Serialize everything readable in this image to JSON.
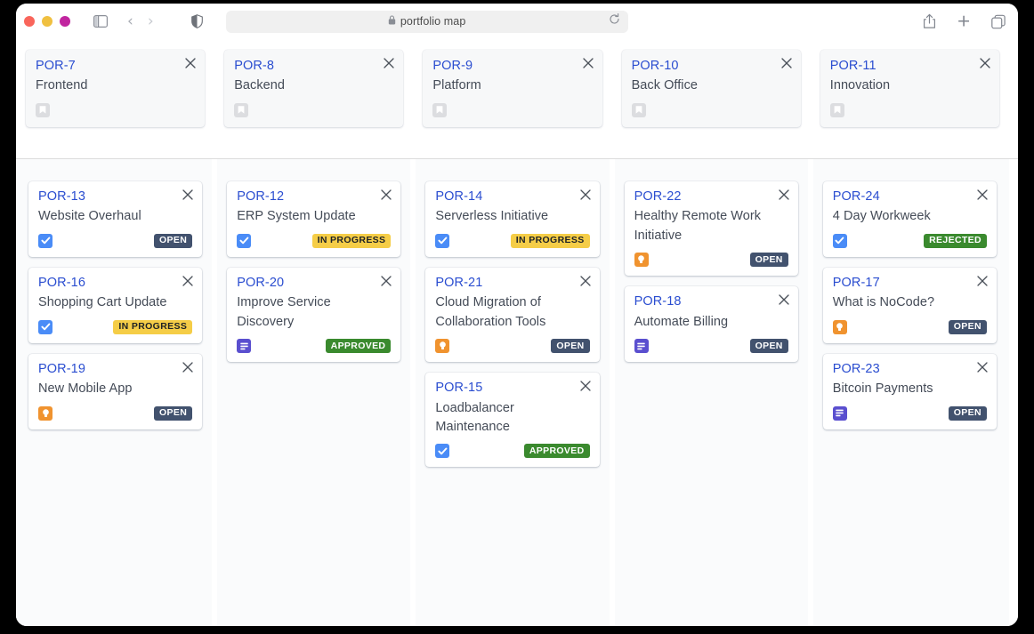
{
  "browser": {
    "url_text": "portfolio map",
    "lock_icon": "lock-icon",
    "reload_icon": "reload-icon",
    "sidebar_icon": "sidebar-toggle-icon",
    "back_glyph": "‹",
    "forward_glyph": "›",
    "shield_icon": "shield-icon",
    "share_icon": "share-icon",
    "new_tab_glyph": "+",
    "tabs_icon": "tab-overview-icon",
    "traffic_lights": [
      "close-red",
      "minimize-yellow",
      "zoom-purple"
    ]
  },
  "board": {
    "epics": [
      {
        "key": "POR-7",
        "title": "Frontend",
        "icon": "epic-bookmark-icon",
        "close": "×"
      },
      {
        "key": "POR-8",
        "title": "Backend",
        "icon": "epic-bookmark-icon",
        "close": "×"
      },
      {
        "key": "POR-9",
        "title": "Platform",
        "icon": "epic-bookmark-icon",
        "close": "×"
      },
      {
        "key": "POR-10",
        "title": "Back Office",
        "icon": "epic-bookmark-icon",
        "close": "×"
      },
      {
        "key": "POR-11",
        "title": "Innovation",
        "icon": "epic-bookmark-icon",
        "close": "×"
      }
    ],
    "columns": [
      {
        "cards": [
          {
            "key": "POR-13",
            "title": "Website Overhaul",
            "type": "task",
            "type_icon": "checkbox-task-icon",
            "status": "OPEN",
            "status_class": "open",
            "close": "×"
          },
          {
            "key": "POR-16",
            "title": "Shopping Cart Update",
            "type": "task",
            "type_icon": "checkbox-task-icon",
            "status": "IN PROGRESS",
            "status_class": "progress",
            "close": "×"
          },
          {
            "key": "POR-19",
            "title": "New Mobile App",
            "type": "idea",
            "type_icon": "lightbulb-idea-icon",
            "status": "OPEN",
            "status_class": "open",
            "close": "×"
          }
        ]
      },
      {
        "cards": [
          {
            "key": "POR-12",
            "title": "ERP System Update",
            "type": "task",
            "type_icon": "checkbox-task-icon",
            "status": "IN PROGRESS",
            "status_class": "progress",
            "close": "×"
          },
          {
            "key": "POR-20",
            "title": "Improve Service Discovery",
            "type": "doc",
            "type_icon": "document-icon",
            "status": "APPROVED",
            "status_class": "approved",
            "close": "×"
          }
        ]
      },
      {
        "cards": [
          {
            "key": "POR-14",
            "title": "Serverless Initiative",
            "type": "task",
            "type_icon": "checkbox-task-icon",
            "status": "IN PROGRESS",
            "status_class": "progress",
            "close": "×"
          },
          {
            "key": "POR-21",
            "title": "Cloud Migration of Collaboration Tools",
            "type": "idea",
            "type_icon": "lightbulb-idea-icon",
            "status": "OPEN",
            "status_class": "open",
            "close": "×"
          },
          {
            "key": "POR-15",
            "title": "Loadbalancer Maintenance",
            "type": "task",
            "type_icon": "checkbox-task-icon",
            "status": "APPROVED",
            "status_class": "approved",
            "close": "×"
          }
        ]
      },
      {
        "cards": [
          {
            "key": "POR-22",
            "title": "Healthy Remote Work Initiative",
            "type": "idea",
            "type_icon": "lightbulb-idea-icon",
            "status": "OPEN",
            "status_class": "open",
            "close": "×"
          },
          {
            "key": "POR-18",
            "title": "Automate Billing",
            "type": "doc",
            "type_icon": "document-icon",
            "status": "OPEN",
            "status_class": "open",
            "close": "×"
          }
        ]
      },
      {
        "cards": [
          {
            "key": "POR-24",
            "title": "4 Day Workweek",
            "type": "task",
            "type_icon": "checkbox-task-icon",
            "status": "REJECTED",
            "status_class": "rejected",
            "close": "×"
          },
          {
            "key": "POR-17",
            "title": "What is NoCode?",
            "type": "idea",
            "type_icon": "lightbulb-idea-icon",
            "status": "OPEN",
            "status_class": "open",
            "close": "×"
          },
          {
            "key": "POR-23",
            "title": "Bitcoin Payments",
            "type": "doc",
            "type_icon": "document-icon",
            "status": "OPEN",
            "status_class": "open",
            "close": "×"
          }
        ]
      }
    ]
  },
  "colors": {
    "key_blue": "#2a4dd0",
    "task_blue": "#4a8cf7",
    "idea_orange": "#f0932f",
    "doc_purple": "#5a4fcf",
    "open_slate": "#42526e",
    "progress_yellow": "#f5cd47",
    "approved_green": "#3a8a2e",
    "column_bg": "#fafbfc"
  }
}
